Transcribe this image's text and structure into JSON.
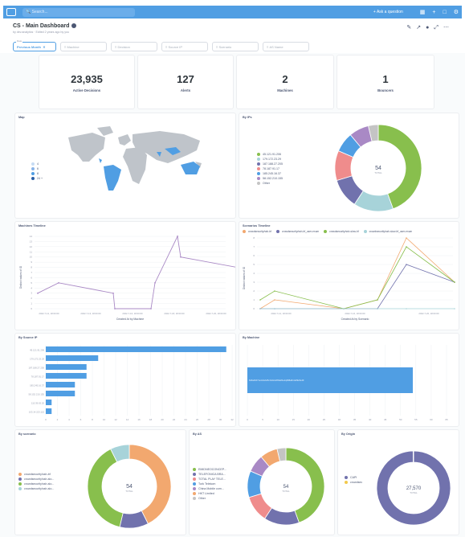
{
  "topbar": {
    "search_placeholder": "Search...",
    "ask": "+ Ask a question"
  },
  "dashboard": {
    "title": "CS - Main Dashboard",
    "subtitle": "by dev.analytics · Edited 2 years ago by you"
  },
  "filters": [
    {
      "label": "Previous Month",
      "caption": "Date"
    },
    {
      "label": "Machine"
    },
    {
      "label": "Decision"
    },
    {
      "label": "Source IP"
    },
    {
      "label": "Scenario"
    },
    {
      "label": "AS Name"
    }
  ],
  "scalars": [
    {
      "value": "23,935",
      "label": "Active Decisions"
    },
    {
      "value": "127",
      "label": "Alerts"
    },
    {
      "value": "2",
      "label": "Machines"
    },
    {
      "value": "1",
      "label": "Bouncers"
    }
  ],
  "map": {
    "title": "Map",
    "legend": [
      "4",
      "6",
      "8",
      "24 +"
    ],
    "legend_colors": [
      "#c7dcf4",
      "#8ab4e8",
      "#509ee3",
      "#2a5ea6"
    ]
  },
  "by_ips": {
    "title": "By IPs",
    "center_value": "54",
    "center_label": "TOTAL",
    "legend": [
      "45.121.91.206",
      "179.172.23.29",
      "187.188.27.205",
      "78.187.91.17",
      "185.245.16.37",
      "58.152.210.155",
      "Other"
    ]
  },
  "colors": [
    "#88bf4d",
    "#a7d3d9",
    "#7172ad",
    "#ef8c8c",
    "#509ee3",
    "#a989c5",
    "#c4c4c4"
  ],
  "machines_timeline": {
    "title": "Machines Timeline",
    "ylabel": "Distinct values of ID",
    "xlabel": "Created At by Machine",
    "xticks": [
      "2022-7-12, 18:00:00",
      "2022-7-13, 18:00:00",
      "2022-7-16, 18:00:00",
      "2022-7-18, 18:00:00",
      "2022-7-20, 18:00:00"
    ],
    "yticks": [
      "0",
      "1",
      "2",
      "3",
      "4",
      "5",
      "6",
      "7",
      "8",
      "9",
      "10",
      "11",
      "12",
      "13",
      "14"
    ]
  },
  "scenario_timeline": {
    "title": "Scenarios Timeline",
    "ylabel": "Distinct values of ID",
    "xlabel": "Created At by Scenario",
    "legend": [
      "crowdsecurity/ssh-bf",
      "crowdsecurity/ssh-bf_user-enum",
      "crowdsecurity/ssh-slow-bf",
      "crowdsecurity/ssh-slow-bf_user-enum"
    ],
    "xticks": [
      "2022-7-12, 18:00:00",
      "2022-7-16, 18:00:00",
      "2022-7-20, 18:00:00"
    ],
    "yticks": [
      "0",
      "1",
      "2",
      "3",
      "4",
      "5",
      "6",
      "7",
      "8"
    ]
  },
  "by_source_ip": {
    "title": "By Source IP",
    "categories": [
      "45.121.91.206",
      "179.172.23.29",
      "187.188.27.205",
      "78.187.91.17",
      "185.245.16.37",
      "58.152.210.155",
      "110.39.63.20",
      "103.14.223.115"
    ],
    "xticks": [
      "0",
      "2",
      "4",
      "6",
      "8",
      "10",
      "12",
      "14",
      "16",
      "18",
      "20",
      "22",
      "24",
      "26",
      "28",
      "30",
      "32"
    ]
  },
  "by_machine": {
    "title": "By Machine",
    "bar_label": "6d9a4b671e4c0ebd5c1bd2e28f4a84a1q0B8a8c4e89e5e49",
    "xticks": [
      "0",
      "5",
      "10",
      "15",
      "20",
      "25",
      "30",
      "35",
      "40",
      "45",
      "50",
      "55",
      "60",
      "65"
    ]
  },
  "by_scenario": {
    "title": "By scenario",
    "center_value": "54",
    "center_label": "TOTAL",
    "legend": [
      "crowdsecurity/ssh-bf",
      "crowdsecurity/ssh-slo...",
      "crowdsecurity/ssh-slo...",
      "crowdsecurity/ssh-slo..."
    ]
  },
  "by_as": {
    "title": "By AS",
    "center_value": "54",
    "center_label": "TOTAL",
    "legend": [
      "EMIDNEOCONCEP...",
      "TELEFONICA BRA...",
      "TOTAL PLAY TELE...",
      "Turk Telekom",
      "China Mobile com...",
      "HKT Limited",
      "Other"
    ]
  },
  "by_origin": {
    "title": "By Origin",
    "center_value": "27,570",
    "center_label": "TOTAL",
    "legend": [
      "CAPI",
      "crowdsec"
    ]
  },
  "chart_data": [
    {
      "type": "pie",
      "title": "By IPs",
      "labels": [
        "45.121.91.206",
        "179.172.23.29",
        "187.188.27.205",
        "78.187.91.17",
        "185.245.16.37",
        "58.152.210.155",
        "Other"
      ],
      "values": [
        24,
        8,
        6,
        6,
        4,
        4,
        2
      ]
    },
    {
      "type": "line",
      "title": "Machines Timeline",
      "xlabel": "Created At by Machine",
      "ylabel": "Distinct values of ID",
      "x": [
        "2022-7-11",
        "2022-7-12",
        "2022-7-15",
        "2022-7-15",
        "2022-7-17",
        "2022-7-18",
        "2022-7-19",
        "2022-7-19",
        "2022-7-21"
      ],
      "series": [
        {
          "values": [
            3,
            5,
            3,
            0,
            0,
            5,
            14,
            10,
            8
          ]
        }
      ],
      "ylim": [
        0,
        14
      ]
    },
    {
      "type": "line",
      "title": "Scenarios Timeline",
      "xlabel": "Created At by Scenario",
      "ylabel": "Distinct values of ID",
      "x": [
        "2022-7-11",
        "2022-7-12",
        "2022-7-16",
        "2022-7-18",
        "2022-7-19",
        "2022-7-21"
      ],
      "series": [
        {
          "name": "crowdsecurity/ssh-bf",
          "values": [
            0,
            1,
            0,
            1,
            8,
            3
          ]
        },
        {
          "name": "crowdsecurity/ssh-bf_user-enum",
          "values": [
            0,
            0,
            0,
            0,
            5,
            3
          ]
        },
        {
          "name": "crowdsecurity/ssh-slow-bf",
          "values": [
            1,
            2,
            0,
            1,
            7,
            3
          ]
        },
        {
          "name": "crowdsecurity/ssh-slow-bf_user-enum",
          "values": [
            0,
            0,
            0,
            0,
            0,
            0
          ]
        }
      ],
      "ylim": [
        0,
        8
      ]
    },
    {
      "type": "bar",
      "title": "By Source IP",
      "categories": [
        "45.121.91.206",
        "179.172.23.29",
        "187.188.27.205",
        "78.187.91.17",
        "185.245.16.37",
        "58.152.210.155",
        "110.39.63.20",
        "103.14.223.115"
      ],
      "values": [
        31,
        9,
        7,
        7,
        5,
        5,
        1,
        1
      ]
    },
    {
      "type": "bar",
      "title": "By Machine",
      "categories": [
        "6d9a4b671e4c0ebd5c1bd2e28f4a84a1q0B8a8c4e89e5e49"
      ],
      "values": [
        54
      ]
    },
    {
      "type": "pie",
      "title": "By scenario",
      "labels": [
        "crowdsecurity/ssh-bf",
        "crowdsecurity/ssh-slo...",
        "crowdsecurity/ssh-slo...",
        "crowdsecurity/ssh-slo..."
      ],
      "values": [
        23,
        6,
        21,
        4
      ]
    },
    {
      "type": "pie",
      "title": "By AS",
      "labels": [
        "EMIDNEOCONCEP...",
        "TELEFONICA BRA...",
        "TOTAL PLAY TELE...",
        "Turk Telekom",
        "China Mobile com...",
        "HKT Limited",
        "Other"
      ],
      "values": [
        24,
        8,
        6,
        6,
        4,
        4,
        2
      ]
    },
    {
      "type": "pie",
      "title": "By Origin",
      "labels": [
        "CAPI",
        "crowdsec"
      ],
      "values": [
        27516,
        54
      ]
    }
  ]
}
